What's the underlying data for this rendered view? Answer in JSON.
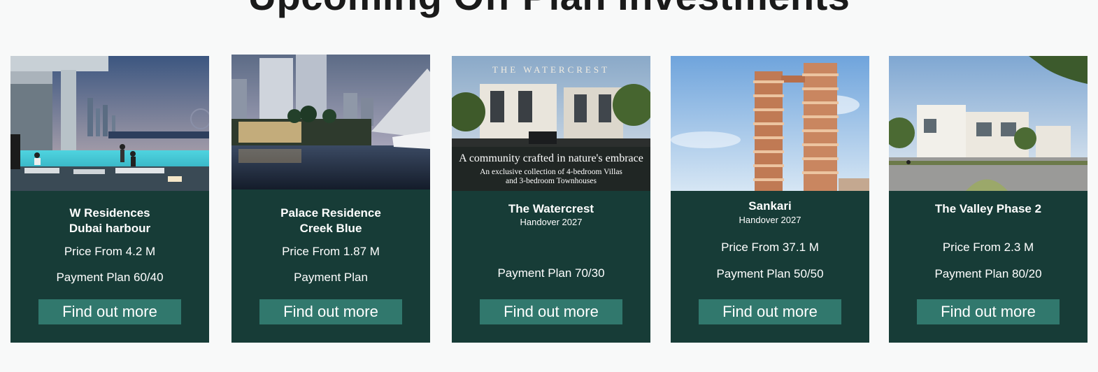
{
  "section": {
    "title": "Upcoming Off Plan Investments"
  },
  "cards": [
    {
      "title_line1": "W Residences",
      "title_line2": "Dubai harbour",
      "price": "Price From 4.2 M",
      "payment": "Payment Plan 60/40",
      "button": "Find out more"
    },
    {
      "title_line1": "Palace Residence",
      "title_line2": "Creek Blue",
      "price": "Price From 1.87 M",
      "payment": "Payment Plan",
      "button": "Find out more"
    },
    {
      "title_line1": "The Watercrest",
      "handover": "Handover 2027",
      "payment": "Payment Plan 70/30",
      "button": "Find out more",
      "image_text": {
        "brand": "THE WATERCREST",
        "tagline": "A community crafted in nature's embrace",
        "desc1": "An exclusive collection of 4-bedroom Villas",
        "desc2": "and 3-bedroom Townhouses"
      }
    },
    {
      "title_line1": "Sankari",
      "handover": "Handover 2027",
      "price": "Price From 37.1 M",
      "payment": "Payment Plan 50/50",
      "button": "Find out more"
    },
    {
      "title_line1": "The Valley Phase 2",
      "price": "Price From 2.3 M",
      "payment": "Payment Plan 80/20",
      "button": "Find out more"
    }
  ],
  "colors": {
    "card_bg": "#173c37",
    "button_bg": "#31786d",
    "page_bg": "#f8f9f9",
    "heading": "#1a1a1a"
  }
}
